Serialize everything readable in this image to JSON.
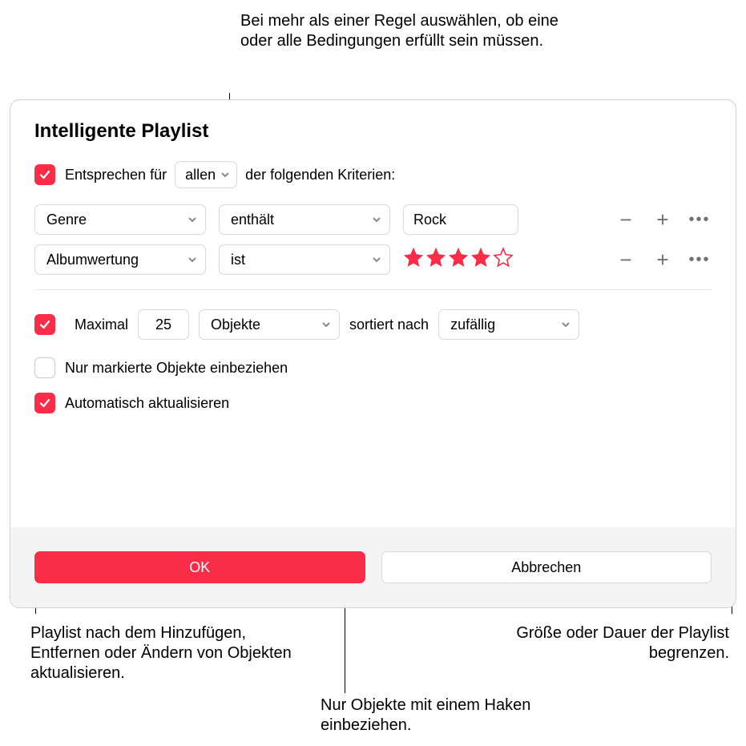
{
  "callouts": {
    "top": "Bei mehr als einer Regel auswählen, ob eine oder alle Bedingungen erfüllt sein müssen.",
    "bottom_left": "Playlist nach dem Hinzufügen, Entfernen oder Ändern von Objekten aktualisieren.",
    "bottom_mid": "Nur Objekte mit einem Haken einbeziehen.",
    "bottom_right": "Größe oder Dauer der Playlist begrenzen."
  },
  "dialog": {
    "title": "Intelligente Playlist",
    "match": {
      "checked": true,
      "prefix": "Entsprechen für",
      "mode": "allen",
      "suffix": "der folgenden Kriterien:"
    },
    "rules": [
      {
        "field": "Genre",
        "operator": "enthält",
        "value_type": "text",
        "value": "Rock"
      },
      {
        "field": "Albumwertung",
        "operator": "ist",
        "value_type": "stars",
        "stars": 4,
        "stars_max": 5
      }
    ],
    "limit": {
      "checked": true,
      "prefix": "Maximal",
      "count": "25",
      "unit": "Objekte",
      "sort_prefix": "sortiert nach",
      "sort": "zufällig"
    },
    "only_checked": {
      "checked": false,
      "label": "Nur markierte Objekte einbeziehen"
    },
    "live_update": {
      "checked": true,
      "label": "Automatisch aktualisieren"
    },
    "buttons": {
      "ok": "OK",
      "cancel": "Abbrechen"
    }
  },
  "icons": {
    "minus": "−",
    "plus": "+",
    "more": "•••"
  }
}
